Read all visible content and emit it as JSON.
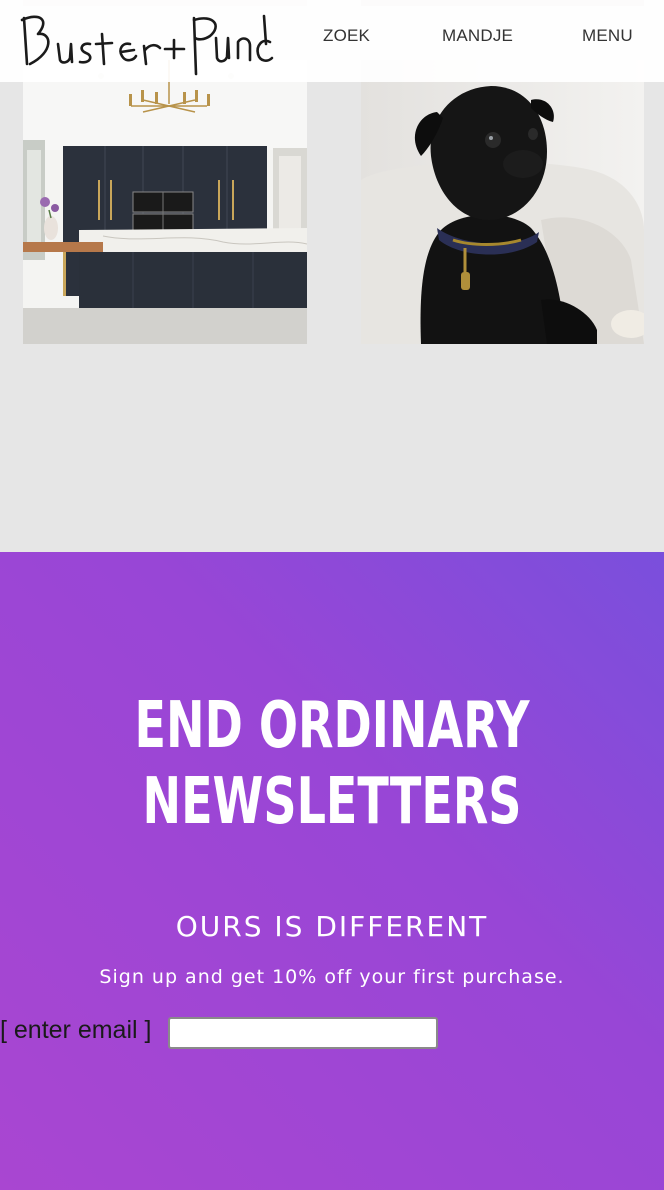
{
  "header": {
    "logo_text": "Buster+Punch",
    "nav": {
      "search": "ZOEK",
      "cart": "MANDJE",
      "menu": "MENU"
    }
  },
  "gallery": {
    "images": [
      "kitchen-photo",
      "pug-photo"
    ]
  },
  "newsletter": {
    "headline_line1": "END ORDINARY",
    "headline_line2": "NEWSLETTERS",
    "subheading": "OURS IS DIFFERENT",
    "description": "Sign up and get 10% off your first purchase.",
    "email_label": "[ enter email ]",
    "email_value": "",
    "gradient_colors": [
      "#7a4fdc",
      "#a946d1"
    ]
  }
}
